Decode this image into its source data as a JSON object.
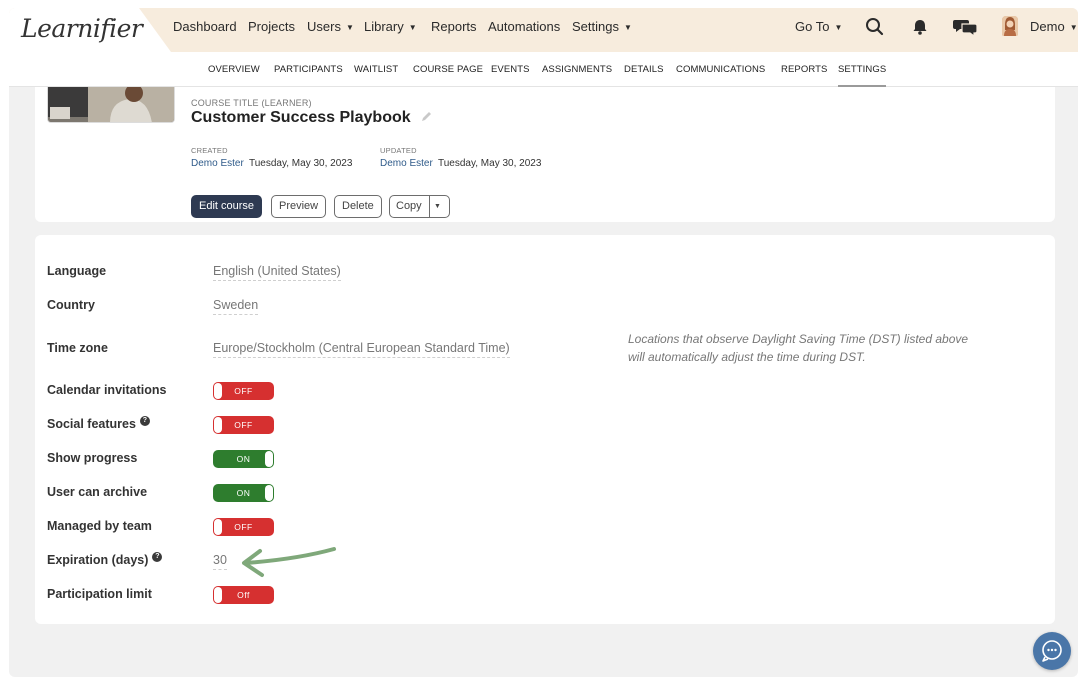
{
  "brand": {
    "logo_text": "Learnifier"
  },
  "topnav": {
    "items": [
      {
        "label": "Dashboard"
      },
      {
        "label": "Projects"
      },
      {
        "label": "Users",
        "has_menu": true
      },
      {
        "label": "Library",
        "has_menu": true
      },
      {
        "label": "Reports"
      },
      {
        "label": "Automations"
      },
      {
        "label": "Settings",
        "has_menu": true
      }
    ],
    "goto_label": "Go To",
    "user_label": "Demo",
    "caret": "▼"
  },
  "subnav": {
    "tabs": [
      {
        "label": "OVERVIEW"
      },
      {
        "label": "PARTICIPANTS"
      },
      {
        "label": "WAITLIST"
      },
      {
        "label": "COURSE PAGE"
      },
      {
        "label": "EVENTS"
      },
      {
        "label": "ASSIGNMENTS"
      },
      {
        "label": "DETAILS"
      },
      {
        "label": "COMMUNICATIONS"
      },
      {
        "label": "REPORTS"
      },
      {
        "label": "SETTINGS",
        "active": true
      }
    ]
  },
  "course": {
    "title_caption": "COURSE TITLE (LEARNER)",
    "title": "Customer Success Playbook",
    "created_caption": "CREATED",
    "created_by": "Demo Ester",
    "created_date": "Tuesday, May 30, 2023",
    "updated_caption": "UPDATED",
    "updated_by": "Demo Ester",
    "updated_date": "Tuesday, May 30, 2023",
    "buttons": {
      "edit": "Edit course",
      "preview": "Preview",
      "delete": "Delete",
      "copy": "Copy"
    }
  },
  "settings": {
    "language": {
      "label": "Language",
      "value": "English (United States)"
    },
    "country": {
      "label": "Country",
      "value": "Sweden"
    },
    "timezone": {
      "label": "Time zone",
      "value": "Europe/Stockholm (Central European Standard Time)",
      "note_line1": "Locations that observe Daylight Saving Time (DST) listed above",
      "note_line2": "will automatically adjust the time during DST."
    },
    "calendar_invitations": {
      "label": "Calendar invitations",
      "state": "OFF"
    },
    "social_features": {
      "label": "Social features",
      "state": "OFF",
      "help": "?"
    },
    "show_progress": {
      "label": "Show progress",
      "state": "ON"
    },
    "user_can_archive": {
      "label": "User can archive",
      "state": "ON"
    },
    "managed_by_team": {
      "label": "Managed by team",
      "state": "OFF"
    },
    "expiration": {
      "label": "Expiration (days)",
      "value": "30",
      "help": "?"
    },
    "participation_limit": {
      "label": "Participation limit",
      "state": "Off"
    }
  },
  "colors": {
    "nav_bg": "#f7ecdd",
    "primary_button": "#2e3a52",
    "toggle_off": "#d63030",
    "toggle_on": "#2e7d2e",
    "link": "#2f5b8a",
    "annotation_arrow": "#7fa87a",
    "chat_bubble": "#4a76a8"
  },
  "icons": [
    "search-icon",
    "bell-icon",
    "chat-icon",
    "pencil-icon",
    "help-icon",
    "chevron-down-icon",
    "chat-bubble-icon"
  ]
}
